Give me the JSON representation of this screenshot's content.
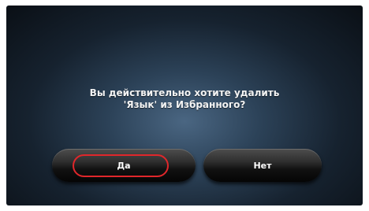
{
  "dialog": {
    "message_line1": "Вы действительно хотите удалить",
    "message_line2": "'Язык' из Избранного?",
    "yes_label": "Да",
    "no_label": "Нет"
  },
  "colors": {
    "highlight": "#e0272b",
    "background": "#2c4258"
  }
}
